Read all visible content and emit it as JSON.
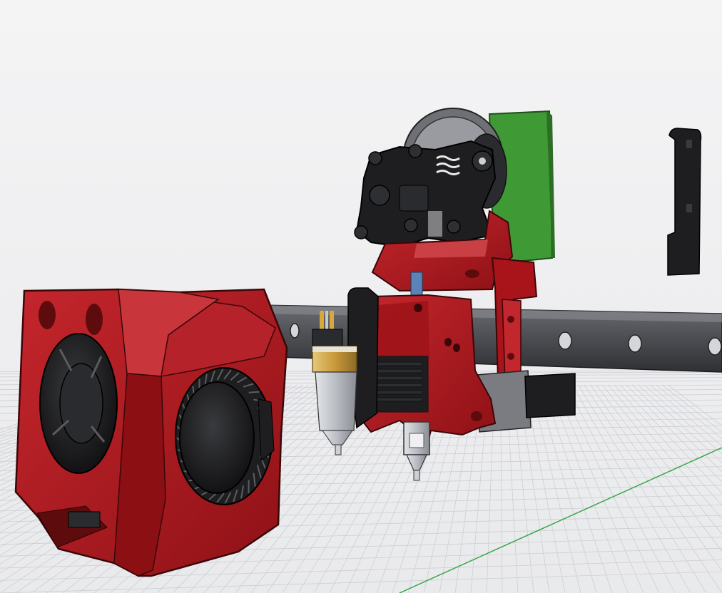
{
  "viewport": {
    "background_top": "#f4f4f5",
    "background_bottom": "#e9eaec",
    "grid_color": "#c9cbd1",
    "axis_line_color": "#3aa64a"
  },
  "model": {
    "part_colors": {
      "red": "#b3161c",
      "red_dark": "#7e0e13",
      "red_light": "#d24a4e",
      "black": "#1e1e20",
      "rail": "#4b4d52",
      "pcb_green": "#3f9a35",
      "brass": "#c99a3b",
      "silver": "#b9bcc2"
    },
    "parts": [
      "cooling-fan-shroud",
      "blower-fan",
      "axial-fan",
      "linear-rail",
      "extruder-gears",
      "extruder-idler",
      "toolhead-pcb",
      "hotend-carriage",
      "heater-block-fins",
      "nozzle",
      "probe-sensor",
      "endstop-bracket",
      "side-bracket"
    ]
  }
}
